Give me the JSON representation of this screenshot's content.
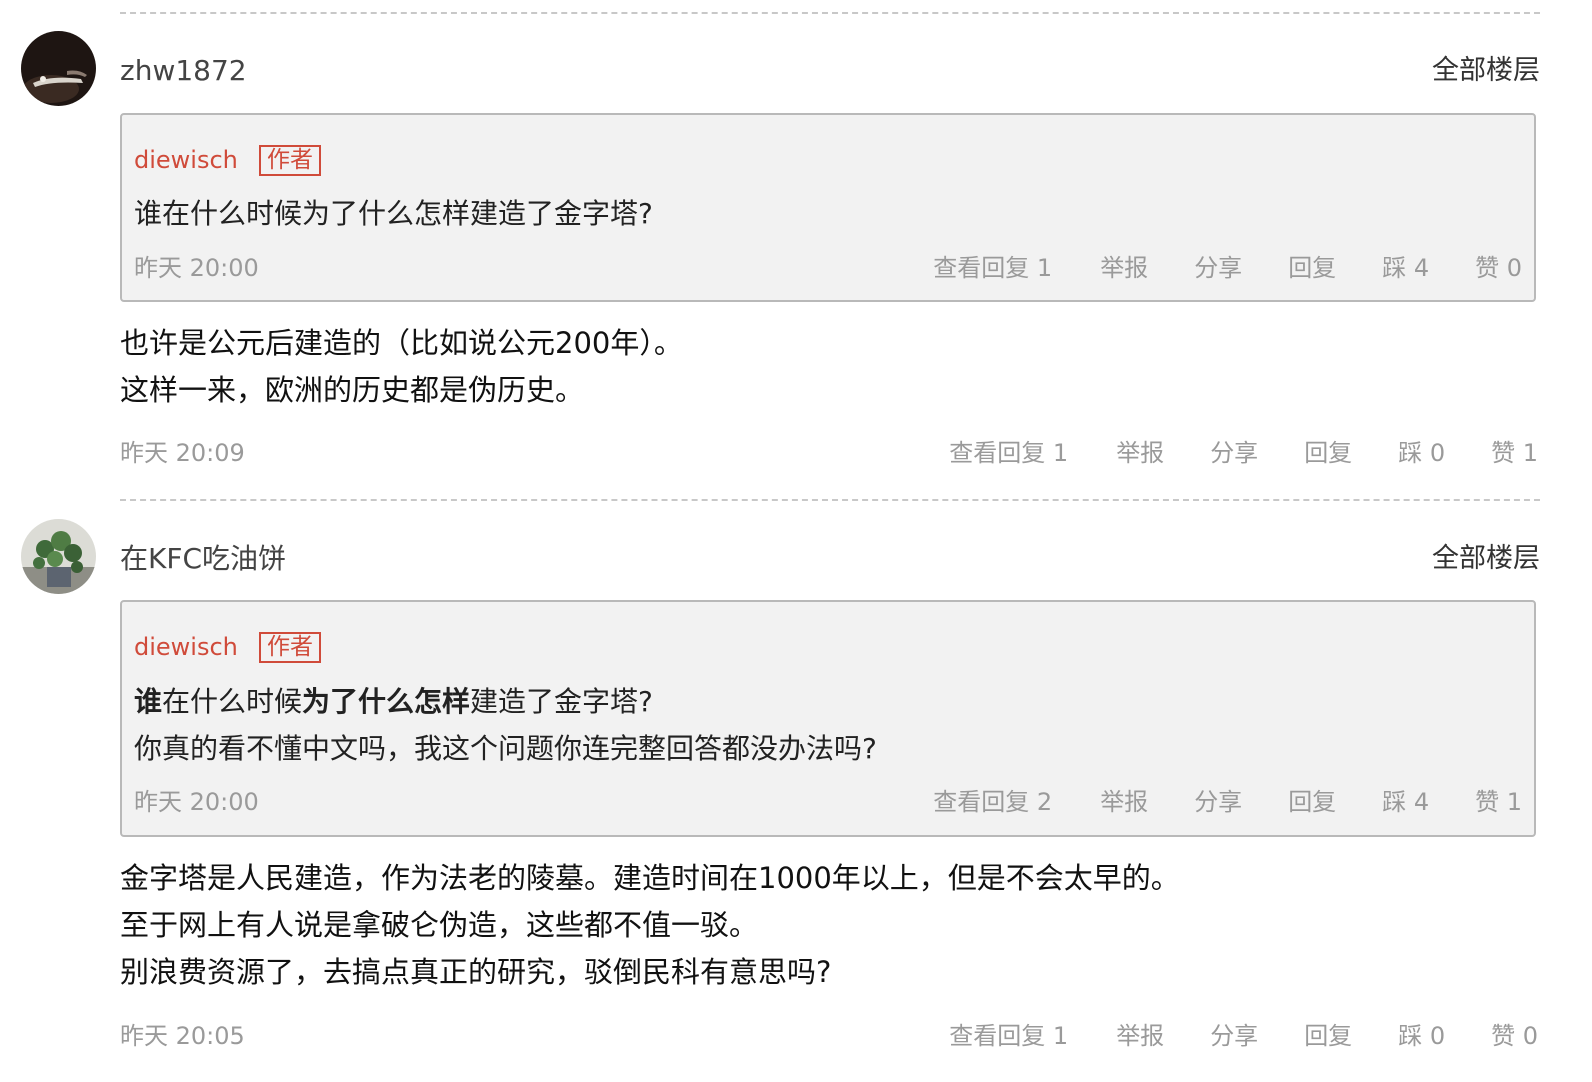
{
  "posts": [
    {
      "username": "zhw1872",
      "all_floors_label": "全部楼层",
      "quote": {
        "author": "diewisch",
        "badge": "作者",
        "lines": [
          "谁在什么时候为了什么怎样建造了金字塔?"
        ],
        "time": "昨天 20:00",
        "actions": {
          "view_replies": "查看回复 1",
          "report": "举报",
          "share": "分享",
          "reply": "回复",
          "dislike": "踩 4",
          "like": "赞 0"
        }
      },
      "reply_lines": [
        "也许是公元后建造的（比如说公元200年）。",
        "这样一来，欧洲的历史都是伪历史。"
      ],
      "time": "昨天 20:09",
      "actions": {
        "view_replies": "查看回复 1",
        "report": "举报",
        "share": "分享",
        "reply": "回复",
        "dislike": "踩 0",
        "like": "赞 1"
      }
    },
    {
      "username": "在KFC吃油饼",
      "all_floors_label": "全部楼层",
      "quote": {
        "author": "diewisch",
        "badge": "作者",
        "line1_parts": [
          "谁",
          "在什么时候",
          "为了什么怎样",
          "建造了金字塔?"
        ],
        "line2": "你真的看不懂中文吗，我这个问题你连完整回答都没办法吗?",
        "time": "昨天 20:00",
        "actions": {
          "view_replies": "查看回复 2",
          "report": "举报",
          "share": "分享",
          "reply": "回复",
          "dislike": "踩 4",
          "like": "赞 1"
        }
      },
      "reply_lines": [
        "金字塔是人民建造，作为法老的陵墓。建造时间在1000年以上，但是不会太早的。",
        "至于网上有人说是拿破仑伪造，这些都不值一驳。",
        "别浪费资源了，去搞点真正的研究，驳倒民科有意思吗?"
      ],
      "time": "昨天 20:05",
      "actions": {
        "view_replies": "查看回复 1",
        "report": "举报",
        "share": "分享",
        "reply": "回复",
        "dislike": "踩 0",
        "like": "赞 0"
      }
    }
  ]
}
